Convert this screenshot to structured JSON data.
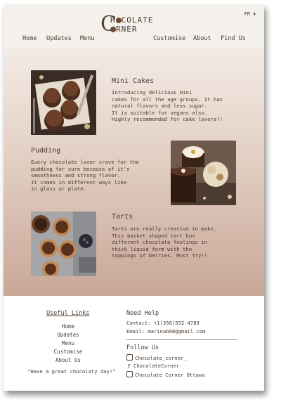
{
  "header": {
    "logo_line1": "H  COLATE",
    "logo_line2": "RNER",
    "lang": "FR",
    "nav": {
      "home": "Home",
      "updates": "Updates",
      "menu": "Menu",
      "customise": "Customise",
      "about": "About",
      "find_us": "Find Us"
    }
  },
  "sections": {
    "mini_cakes": {
      "title": "Mini Cakes",
      "text": "Introducing delicious mini\ncakes for all the age groups. It has\nnatural flavors and less sugar.\nIt is suitable for vegans also.\nHighly recommended for cake lovers!!"
    },
    "pudding": {
      "title": "Pudding",
      "text": "Every chocolate lover crave for the\npudding for sure because of it's\nsmoothness and strong flavor.\nIt comes in different ways like\nin glass or plate."
    },
    "tarts": {
      "title": "Tarts",
      "text": "Tarts are really creative to make.\nThis basket shaped tart has\ndifferent chocolate feelings in\nthick liquid form with the\ntoppings of berries. Must try!!"
    }
  },
  "footer": {
    "useful_links_title": "Useful Links",
    "links": [
      "Home",
      "Updates",
      "Menu",
      "Customise",
      "About Us"
    ],
    "tagline": "\"Have a great chocolaty day!\"",
    "need_help_title": "Need Help",
    "contact": "Contact: +1(356)552-4789",
    "email": "Email: marinab08@gmail.com",
    "follow_title": "Follow Us",
    "instagram": "Chocolate_corner_",
    "facebook": "ChocolateCorner",
    "youtube": "Chocolate Corner Ottawa"
  }
}
